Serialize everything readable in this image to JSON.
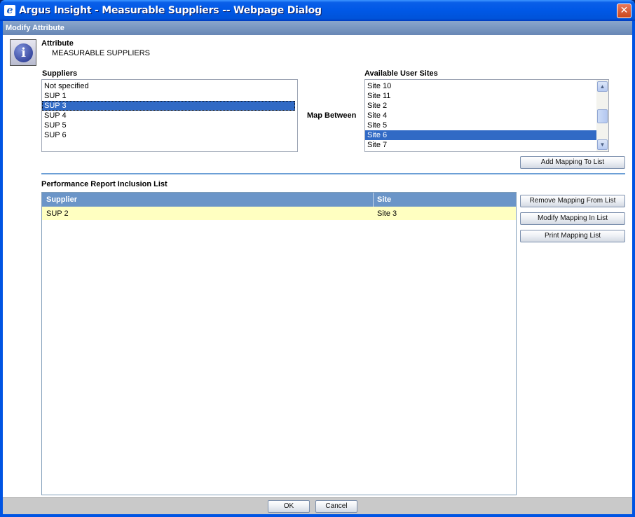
{
  "window": {
    "title": "Argus Insight - Measurable Suppliers -- Webpage Dialog",
    "icon_name": "ie-page-icon",
    "close_glyph": "✕"
  },
  "section": {
    "title": "Modify Attribute"
  },
  "attribute": {
    "label": "Attribute",
    "value": "MEASURABLE SUPPLIERS",
    "icon_name": "info-icon",
    "icon_glyph": "i"
  },
  "suppliers": {
    "label": "Suppliers",
    "items": [
      "Not specified",
      "SUP 1",
      "SUP 3",
      "SUP 4",
      "SUP 5",
      "SUP 6"
    ],
    "selected_index": 2
  },
  "map_between_label": "Map Between",
  "sites": {
    "label": "Available User Sites",
    "items": [
      "Site 10",
      "Site 11",
      "Site 2",
      "Site 4",
      "Site 5",
      "Site 6",
      "Site 7"
    ],
    "selected_index": 5
  },
  "buttons": {
    "add_mapping": "Add Mapping To List",
    "remove_mapping": "Remove Mapping From List",
    "modify_mapping": "Modify Mapping In List",
    "print_mapping": "Print Mapping List",
    "ok": "OK",
    "cancel": "Cancel"
  },
  "inclusion": {
    "label": "Performance Report Inclusion List",
    "columns": [
      "Supplier",
      "Site"
    ],
    "rows": [
      {
        "supplier": "SUP 2",
        "site": "Site 3"
      }
    ]
  },
  "colors": {
    "selection": "#316ac5",
    "header": "#6b95c8",
    "row_highlight": "#ffffc1",
    "titlebar": "#0058e6"
  }
}
